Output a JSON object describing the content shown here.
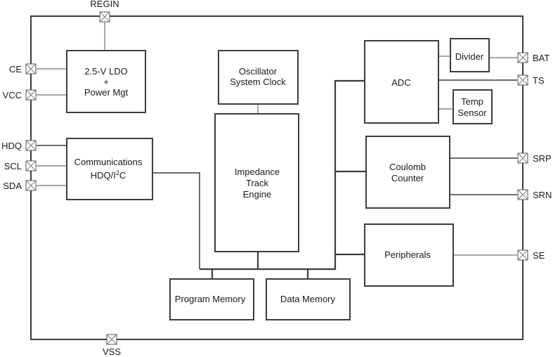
{
  "diagram": {
    "type": "block-diagram",
    "pins": {
      "regin": "REGIN",
      "ce": "CE",
      "vcc": "VCC",
      "hdq": "HDQ",
      "scl": "SCL",
      "sda": "SDA",
      "vss": "VSS",
      "bat": "BAT",
      "ts": "TS",
      "srp": "SRP",
      "srn": "SRN",
      "se": "SE"
    },
    "blocks": {
      "ldo": {
        "line1": "2.5-V LDO",
        "line2": "+",
        "line3": "Power Mgt"
      },
      "comm": {
        "line1": "Communications",
        "line2_pre": "HDQ/I",
        "line2_sup": "2",
        "line2_post": "C"
      },
      "osc": {
        "line1": "Oscillator",
        "line2": "System Clock"
      },
      "ite": {
        "line1": "Impedance",
        "line2": "Track",
        "line3": "Engine"
      },
      "adc": {
        "line1": "ADC"
      },
      "divider": {
        "line1": "Divider"
      },
      "temp": {
        "line1": "Temp",
        "line2": "Sensor"
      },
      "coulomb": {
        "line1": "Coulomb",
        "line2": "Counter"
      },
      "periph": {
        "line1": "Peripherals"
      },
      "progmem": {
        "line1": "Program Memory"
      },
      "datamem": {
        "line1": "Data Memory"
      }
    },
    "connections": [
      [
        "REGIN",
        "2.5-V LDO + Power Mgt"
      ],
      [
        "CE",
        "2.5-V LDO + Power Mgt"
      ],
      [
        "VCC",
        "2.5-V LDO + Power Mgt"
      ],
      [
        "HDQ",
        "Communications HDQ/I2C"
      ],
      [
        "SCL",
        "Communications HDQ/I2C"
      ],
      [
        "SDA",
        "Communications HDQ/I2C"
      ],
      [
        "Oscillator System Clock",
        "Impedance Track Engine"
      ],
      [
        "Communications HDQ/I2C",
        "internal bus"
      ],
      [
        "Impedance Track Engine",
        "internal bus"
      ],
      [
        "Program Memory",
        "internal bus"
      ],
      [
        "Data Memory",
        "internal bus"
      ],
      [
        "ADC",
        "internal bus"
      ],
      [
        "Coulomb Counter",
        "internal bus"
      ],
      [
        "Peripherals",
        "internal bus"
      ],
      [
        "ADC",
        "Divider"
      ],
      [
        "Divider",
        "BAT"
      ],
      [
        "ADC",
        "TS"
      ],
      [
        "ADC",
        "Temp Sensor"
      ],
      [
        "Coulomb Counter",
        "SRP"
      ],
      [
        "Coulomb Counter",
        "SRN"
      ],
      [
        "Peripherals",
        "SE"
      ]
    ]
  }
}
